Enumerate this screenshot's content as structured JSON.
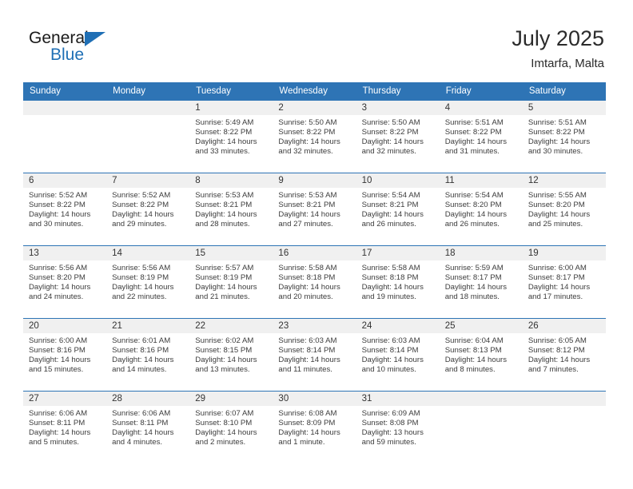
{
  "brand": {
    "name_top": "General",
    "name_bottom": "Blue",
    "accent_color": "#1f6fb5"
  },
  "header": {
    "title": "July 2025",
    "location": "Imtarfa, Malta"
  },
  "theme": {
    "header_row_bg": "#2e74b5",
    "daynum_band_bg": "#f0f0f0",
    "row_divider": "#2e74b5",
    "text": "#3c3c3c"
  },
  "weekday_headers": [
    "Sunday",
    "Monday",
    "Tuesday",
    "Wednesday",
    "Thursday",
    "Friday",
    "Saturday"
  ],
  "weeks": [
    [
      {
        "day": "",
        "empty": true
      },
      {
        "day": "",
        "empty": true
      },
      {
        "day": "1",
        "sunrise": "Sunrise: 5:49 AM",
        "sunset": "Sunset: 8:22 PM",
        "daylight1": "Daylight: 14 hours",
        "daylight2": "and 33 minutes."
      },
      {
        "day": "2",
        "sunrise": "Sunrise: 5:50 AM",
        "sunset": "Sunset: 8:22 PM",
        "daylight1": "Daylight: 14 hours",
        "daylight2": "and 32 minutes."
      },
      {
        "day": "3",
        "sunrise": "Sunrise: 5:50 AM",
        "sunset": "Sunset: 8:22 PM",
        "daylight1": "Daylight: 14 hours",
        "daylight2": "and 32 minutes."
      },
      {
        "day": "4",
        "sunrise": "Sunrise: 5:51 AM",
        "sunset": "Sunset: 8:22 PM",
        "daylight1": "Daylight: 14 hours",
        "daylight2": "and 31 minutes."
      },
      {
        "day": "5",
        "sunrise": "Sunrise: 5:51 AM",
        "sunset": "Sunset: 8:22 PM",
        "daylight1": "Daylight: 14 hours",
        "daylight2": "and 30 minutes."
      }
    ],
    [
      {
        "day": "6",
        "sunrise": "Sunrise: 5:52 AM",
        "sunset": "Sunset: 8:22 PM",
        "daylight1": "Daylight: 14 hours",
        "daylight2": "and 30 minutes."
      },
      {
        "day": "7",
        "sunrise": "Sunrise: 5:52 AM",
        "sunset": "Sunset: 8:22 PM",
        "daylight1": "Daylight: 14 hours",
        "daylight2": "and 29 minutes."
      },
      {
        "day": "8",
        "sunrise": "Sunrise: 5:53 AM",
        "sunset": "Sunset: 8:21 PM",
        "daylight1": "Daylight: 14 hours",
        "daylight2": "and 28 minutes."
      },
      {
        "day": "9",
        "sunrise": "Sunrise: 5:53 AM",
        "sunset": "Sunset: 8:21 PM",
        "daylight1": "Daylight: 14 hours",
        "daylight2": "and 27 minutes."
      },
      {
        "day": "10",
        "sunrise": "Sunrise: 5:54 AM",
        "sunset": "Sunset: 8:21 PM",
        "daylight1": "Daylight: 14 hours",
        "daylight2": "and 26 minutes."
      },
      {
        "day": "11",
        "sunrise": "Sunrise: 5:54 AM",
        "sunset": "Sunset: 8:20 PM",
        "daylight1": "Daylight: 14 hours",
        "daylight2": "and 26 minutes."
      },
      {
        "day": "12",
        "sunrise": "Sunrise: 5:55 AM",
        "sunset": "Sunset: 8:20 PM",
        "daylight1": "Daylight: 14 hours",
        "daylight2": "and 25 minutes."
      }
    ],
    [
      {
        "day": "13",
        "sunrise": "Sunrise: 5:56 AM",
        "sunset": "Sunset: 8:20 PM",
        "daylight1": "Daylight: 14 hours",
        "daylight2": "and 24 minutes."
      },
      {
        "day": "14",
        "sunrise": "Sunrise: 5:56 AM",
        "sunset": "Sunset: 8:19 PM",
        "daylight1": "Daylight: 14 hours",
        "daylight2": "and 22 minutes."
      },
      {
        "day": "15",
        "sunrise": "Sunrise: 5:57 AM",
        "sunset": "Sunset: 8:19 PM",
        "daylight1": "Daylight: 14 hours",
        "daylight2": "and 21 minutes."
      },
      {
        "day": "16",
        "sunrise": "Sunrise: 5:58 AM",
        "sunset": "Sunset: 8:18 PM",
        "daylight1": "Daylight: 14 hours",
        "daylight2": "and 20 minutes."
      },
      {
        "day": "17",
        "sunrise": "Sunrise: 5:58 AM",
        "sunset": "Sunset: 8:18 PM",
        "daylight1": "Daylight: 14 hours",
        "daylight2": "and 19 minutes."
      },
      {
        "day": "18",
        "sunrise": "Sunrise: 5:59 AM",
        "sunset": "Sunset: 8:17 PM",
        "daylight1": "Daylight: 14 hours",
        "daylight2": "and 18 minutes."
      },
      {
        "day": "19",
        "sunrise": "Sunrise: 6:00 AM",
        "sunset": "Sunset: 8:17 PM",
        "daylight1": "Daylight: 14 hours",
        "daylight2": "and 17 minutes."
      }
    ],
    [
      {
        "day": "20",
        "sunrise": "Sunrise: 6:00 AM",
        "sunset": "Sunset: 8:16 PM",
        "daylight1": "Daylight: 14 hours",
        "daylight2": "and 15 minutes."
      },
      {
        "day": "21",
        "sunrise": "Sunrise: 6:01 AM",
        "sunset": "Sunset: 8:16 PM",
        "daylight1": "Daylight: 14 hours",
        "daylight2": "and 14 minutes."
      },
      {
        "day": "22",
        "sunrise": "Sunrise: 6:02 AM",
        "sunset": "Sunset: 8:15 PM",
        "daylight1": "Daylight: 14 hours",
        "daylight2": "and 13 minutes."
      },
      {
        "day": "23",
        "sunrise": "Sunrise: 6:03 AM",
        "sunset": "Sunset: 8:14 PM",
        "daylight1": "Daylight: 14 hours",
        "daylight2": "and 11 minutes."
      },
      {
        "day": "24",
        "sunrise": "Sunrise: 6:03 AM",
        "sunset": "Sunset: 8:14 PM",
        "daylight1": "Daylight: 14 hours",
        "daylight2": "and 10 minutes."
      },
      {
        "day": "25",
        "sunrise": "Sunrise: 6:04 AM",
        "sunset": "Sunset: 8:13 PM",
        "daylight1": "Daylight: 14 hours",
        "daylight2": "and 8 minutes."
      },
      {
        "day": "26",
        "sunrise": "Sunrise: 6:05 AM",
        "sunset": "Sunset: 8:12 PM",
        "daylight1": "Daylight: 14 hours",
        "daylight2": "and 7 minutes."
      }
    ],
    [
      {
        "day": "27",
        "sunrise": "Sunrise: 6:06 AM",
        "sunset": "Sunset: 8:11 PM",
        "daylight1": "Daylight: 14 hours",
        "daylight2": "and 5 minutes."
      },
      {
        "day": "28",
        "sunrise": "Sunrise: 6:06 AM",
        "sunset": "Sunset: 8:11 PM",
        "daylight1": "Daylight: 14 hours",
        "daylight2": "and 4 minutes."
      },
      {
        "day": "29",
        "sunrise": "Sunrise: 6:07 AM",
        "sunset": "Sunset: 8:10 PM",
        "daylight1": "Daylight: 14 hours",
        "daylight2": "and 2 minutes."
      },
      {
        "day": "30",
        "sunrise": "Sunrise: 6:08 AM",
        "sunset": "Sunset: 8:09 PM",
        "daylight1": "Daylight: 14 hours",
        "daylight2": "and 1 minute."
      },
      {
        "day": "31",
        "sunrise": "Sunrise: 6:09 AM",
        "sunset": "Sunset: 8:08 PM",
        "daylight1": "Daylight: 13 hours",
        "daylight2": "and 59 minutes."
      },
      {
        "day": "",
        "empty": true
      },
      {
        "day": "",
        "empty": true
      }
    ]
  ]
}
